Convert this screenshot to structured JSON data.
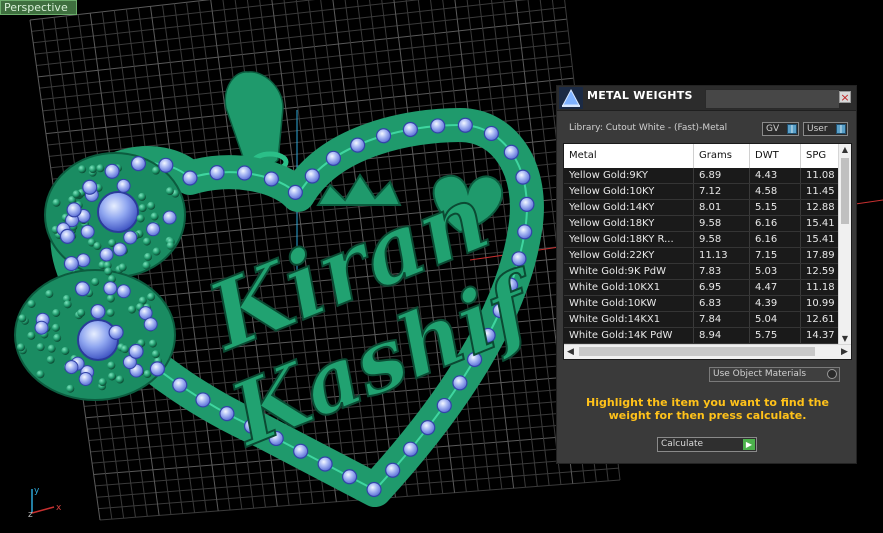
{
  "viewport": {
    "label": "Perspective",
    "name_line1": "Kiran",
    "name_line2": "Kashif",
    "axis_x": "x",
    "axis_y": "y",
    "axis_z": "z"
  },
  "panel": {
    "title": "METAL WEIGHTS",
    "close_glyph": "×",
    "library_label": "Library: Cutout White - (Fast)-Metal",
    "gv_label": "GV",
    "user_label": "User",
    "columns": [
      "Metal",
      "Grams",
      "DWT",
      "SPG"
    ],
    "rows": [
      {
        "metal": "Yellow Gold:9KY",
        "grams": "6.89",
        "dwt": "4.43",
        "spg": "11.08"
      },
      {
        "metal": "Yellow Gold:10KY",
        "grams": "7.12",
        "dwt": "4.58",
        "spg": "11.45"
      },
      {
        "metal": "Yellow Gold:14KY",
        "grams": "8.01",
        "dwt": "5.15",
        "spg": "12.88"
      },
      {
        "metal": "Yellow Gold:18KY",
        "grams": "9.58",
        "dwt": "6.16",
        "spg": "15.41"
      },
      {
        "metal": "Yellow Gold:18KY R...",
        "grams": "9.58",
        "dwt": "6.16",
        "spg": "15.41"
      },
      {
        "metal": "Yellow Gold:22KY",
        "grams": "11.13",
        "dwt": "7.15",
        "spg": "17.89"
      },
      {
        "metal": "White Gold:9K PdW",
        "grams": "7.83",
        "dwt": "5.03",
        "spg": "12.59"
      },
      {
        "metal": "White Gold:10KX1",
        "grams": "6.95",
        "dwt": "4.47",
        "spg": "11.18"
      },
      {
        "metal": "White Gold:10KW",
        "grams": "6.83",
        "dwt": "4.39",
        "spg": "10.99"
      },
      {
        "metal": "White Gold:14KX1",
        "grams": "7.84",
        "dwt": "5.04",
        "spg": "12.61"
      },
      {
        "metal": "White Gold:14K PdW",
        "grams": "8.94",
        "dwt": "5.75",
        "spg": "14.37"
      }
    ],
    "use_object_materials": "Use Object Materials",
    "hint": "Highlight the item you want to find the weight for then press calculate.",
    "calculate_label": "Calculate"
  }
}
